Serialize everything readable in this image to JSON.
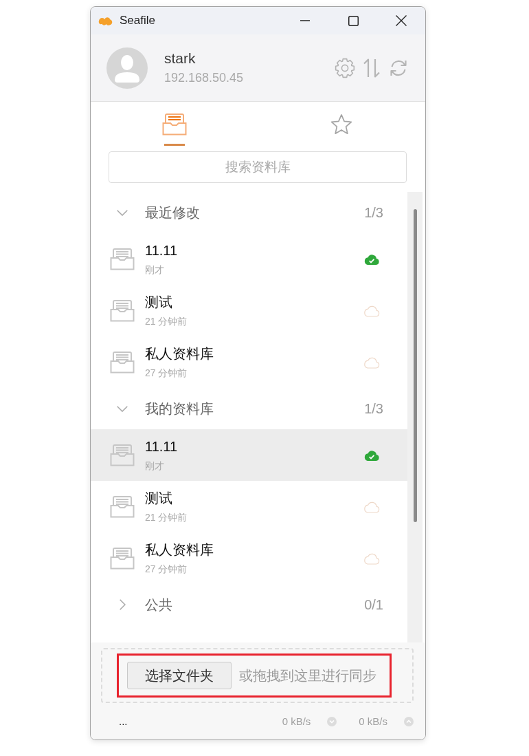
{
  "window": {
    "title": "Seafile"
  },
  "account": {
    "name": "stark",
    "server": "192.168.50.45"
  },
  "tabs": [
    {
      "kind": "libraries",
      "selected": true
    },
    {
      "kind": "starred",
      "selected": false
    }
  ],
  "search": {
    "placeholder": "搜索资料库"
  },
  "groups": [
    {
      "title": "最近修改",
      "count": "1/3",
      "expanded": true,
      "libraries": [
        {
          "name": "11.11",
          "time": "刚才",
          "synced": true,
          "selected": false
        },
        {
          "name": "测试",
          "time": "21 分钟前",
          "synced": false,
          "selected": false
        },
        {
          "name": "私人资料库",
          "time": "27 分钟前",
          "synced": false,
          "selected": false
        }
      ]
    },
    {
      "title": "我的资料库",
      "count": "1/3",
      "expanded": true,
      "libraries": [
        {
          "name": "11.11",
          "time": "刚才",
          "synced": true,
          "selected": true
        },
        {
          "name": "测试",
          "time": "21 分钟前",
          "synced": false,
          "selected": false
        },
        {
          "name": "私人资料库",
          "time": "27 分钟前",
          "synced": false,
          "selected": false
        }
      ]
    },
    {
      "title": "公共",
      "count": "0/1",
      "expanded": false
    }
  ],
  "drop_zone": {
    "button": "选择文件夹",
    "hint": "或拖拽到这里进行同步"
  },
  "status_bar": {
    "text": "...",
    "download": "0 kB/s",
    "upload": "0 kB/s"
  }
}
